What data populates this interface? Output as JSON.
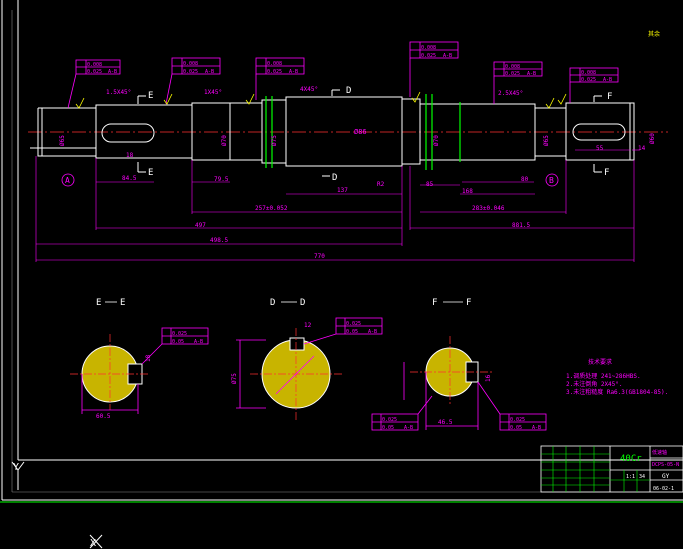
{
  "drawing": {
    "material": "40Cr",
    "roughness_corner": "其余",
    "hatch_label": "剖面",
    "tech_req_title": "技术要求",
    "tech_req": [
      "1.调质处理 241~286HBS.",
      "2.未注倒角 2X45°.",
      "3.未注粗糙度 Ra6.3(GB1804-85)."
    ],
    "title_block": {
      "name": "低速轴",
      "drawing_no": "DCPS-05-N",
      "scale": "1:1",
      "sheet": "34",
      "date": "06-02-1",
      "unit": "GY"
    }
  },
  "shaft": {
    "chamfers": [
      "1.5X45°",
      "1X45°",
      "4X45°",
      "2.5X45°"
    ],
    "lengths": [
      "84.5",
      "79.5",
      "137",
      "R2",
      "85",
      "168",
      "80",
      "55",
      "14"
    ],
    "overall": [
      "497",
      "257±0.052",
      "283±0.046",
      "498.5",
      "881.5",
      "770"
    ],
    "datums": [
      "A",
      "B"
    ],
    "diameters": [
      "Ø65",
      "Ø70",
      "Ø75",
      "Ø86",
      "Ø70",
      "Ø65",
      "Ø60"
    ],
    "key_width": "18",
    "runout": [
      "0.008",
      "0.025",
      "A-B"
    ]
  },
  "sections": [
    {
      "label_left": "E",
      "label_right": "E",
      "dim": "60.5",
      "key": "18",
      "tol1": "0.025",
      "tol2": "0.05",
      "ref": "A-B"
    },
    {
      "label_left": "D",
      "label_right": "D",
      "dim": "Ø75",
      "key": "12",
      "tol1": "0.025",
      "tol2": "0.05",
      "ref": "A-B"
    },
    {
      "label_left": "F",
      "label_right": "F",
      "dim": "46.5",
      "key": "16",
      "tol1": "0.025",
      "tol2": "0.05",
      "ref": "A-B"
    }
  ],
  "axes": {
    "y": "Y",
    "x": "X"
  }
}
